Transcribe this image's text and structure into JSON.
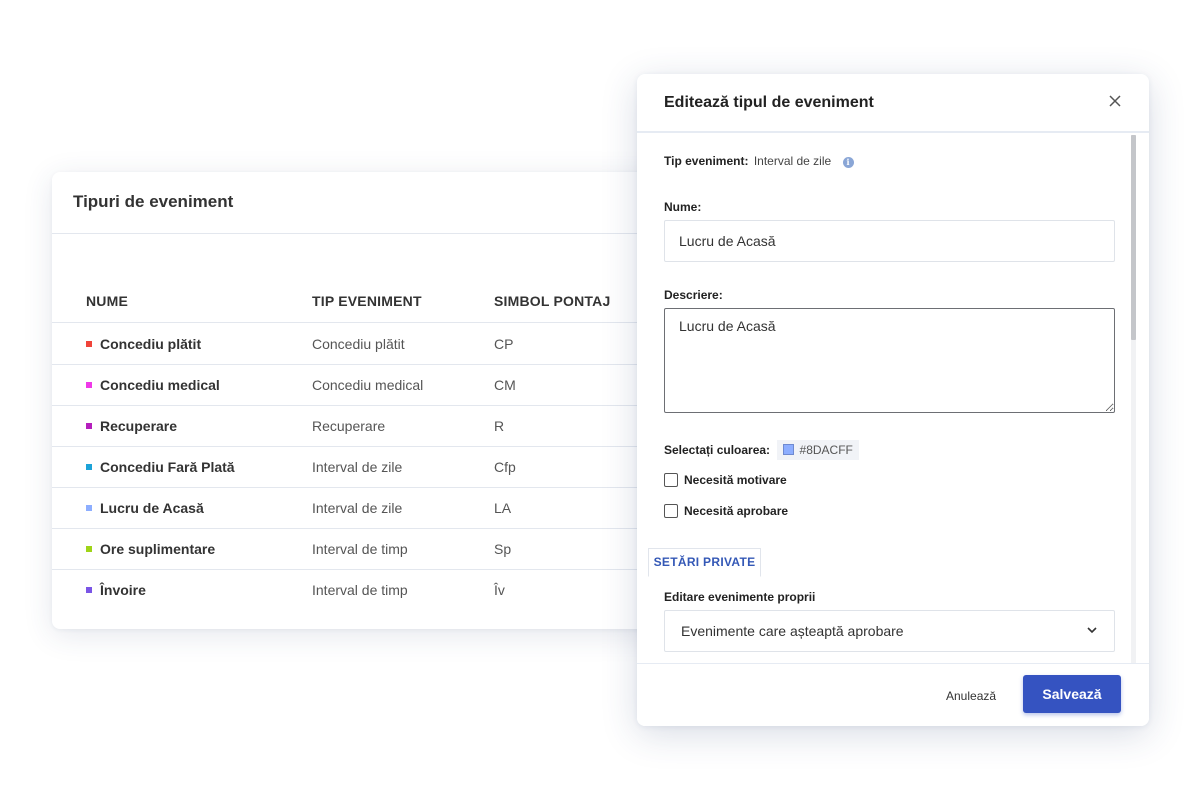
{
  "list": {
    "title": "Tipuri de eveniment",
    "columns": {
      "name": "NUME",
      "type": "TIP EVENIMENT",
      "symbol": "SIMBOL PONTAJ"
    },
    "rows": [
      {
        "name": "Concediu plătit",
        "type": "Concediu plătit",
        "symbol": "CP",
        "color": "#f0443a"
      },
      {
        "name": "Concediu medical",
        "type": "Concediu medical",
        "symbol": "CM",
        "color": "#ef39e8"
      },
      {
        "name": "Recuperare",
        "type": "Recuperare",
        "symbol": "R",
        "color": "#b51fbd"
      },
      {
        "name": "Concediu Fară Plată",
        "type": "Interval de zile",
        "symbol": "Cfp",
        "color": "#1ca3d8"
      },
      {
        "name": "Lucru de Acasă",
        "type": "Interval de zile",
        "symbol": "LA",
        "color": "#8daeff"
      },
      {
        "name": "Ore suplimentare",
        "type": "Interval de timp",
        "symbol": "Sp",
        "color": "#9fd418"
      },
      {
        "name": "Învoire",
        "type": "Interval de timp",
        "symbol": "Îv",
        "color": "#7a55e6"
      }
    ]
  },
  "modal": {
    "title": "Editează tipul de eveniment",
    "close_icon": "close-icon",
    "event_type_label": "Tip eveniment:",
    "event_type_value": "Interval de zile",
    "info_icon": "info-icon",
    "info_glyph": "i",
    "name_label": "Nume:",
    "name_value": "Lucru de Acasă",
    "description_label": "Descriere:",
    "description_value": "Lucru de Acasă",
    "color_label": "Selectați culoarea:",
    "color_value": "#8DACFF",
    "color_hex": "#8daeff",
    "checkbox_reason": "Necesită motivare",
    "checkbox_approval": "Necesită aprobare",
    "tab_private": "SETĂRI PRIVATE",
    "own_events_label": "Editare evenimente proprii",
    "own_events_value": "Evenimente care așteaptă aprobare",
    "cancel_label": "Anulează",
    "save_label": "Salvează",
    "accent_color": "#3553c1"
  }
}
